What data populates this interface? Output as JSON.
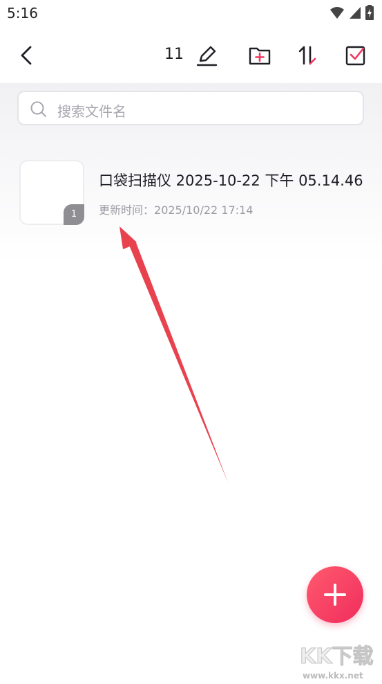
{
  "status_bar": {
    "time": "5:16"
  },
  "toolbar": {
    "count": "11"
  },
  "search": {
    "placeholder": "搜索文件名"
  },
  "files": [
    {
      "title": "口袋扫描仪 2025-10-22 下午 05.14.46",
      "updated_label": "更新时间：",
      "updated_value": "2025/10/22 17:14",
      "page_count": "1"
    }
  ],
  "watermark": {
    "logo": "KK下载",
    "url": "www.kkx.net"
  },
  "colors": {
    "accent": "#f0365e",
    "arrow": "#e8424f"
  },
  "icons": [
    "back-arrow-icon",
    "edit-pencil-icon",
    "new-folder-icon",
    "sort-icon",
    "select-checkbox-icon",
    "search-icon",
    "plus-icon",
    "wifi-icon",
    "signal-icon",
    "battery-icon"
  ]
}
